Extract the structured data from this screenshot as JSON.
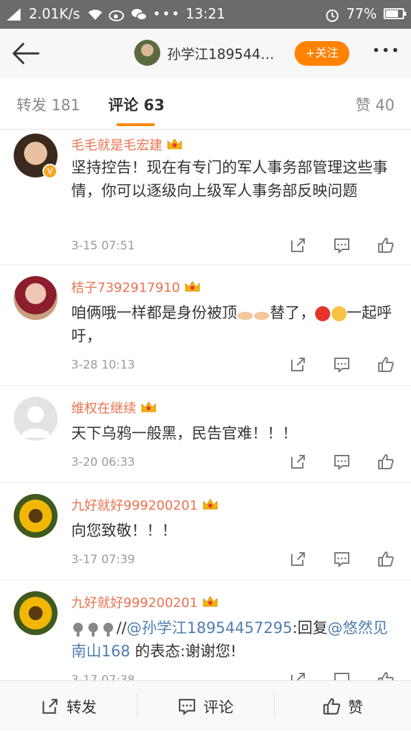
{
  "status_bar": {
    "speed": "2.01K/s",
    "time": "13:21",
    "battery_percent": "77%",
    "battery_level": 0.77
  },
  "nav": {
    "user_name": "孙学江189544…",
    "follow_label": "+关注"
  },
  "tabs": {
    "repost": "转发 181",
    "comments": "评论 63",
    "likes": "赞 40"
  },
  "comments": [
    {
      "name": "毛毛就是毛宏建",
      "text": "坚持控告！现在有专门的军人事务部管理这些事情，你可以逐级向上级军人事务部反映问题",
      "time": "3-15 07:51"
    },
    {
      "name": "桔子7392917910",
      "text_before": "咱俩哦一样都是身份被顶",
      "text_middle": "替了，",
      "text_after": "一起呼吁，",
      "time": "3-28 10:13"
    },
    {
      "name": "维权在继续",
      "text": "天下乌鸦一般黑，民告官难！！！",
      "time": "3-20 06:33"
    },
    {
      "name": "九好就好999200201",
      "text": "向您致敬！！！",
      "time": "3-17 07:39"
    },
    {
      "name": "九好就好999200201",
      "text_prefix": "//",
      "mention1": "@孙学江18954457295",
      "text_mid": ":回复",
      "mention2": "@悠然见南山168",
      "text_end": " 的表态:谢谢您!",
      "time": "3-17 07:38"
    }
  ],
  "bottom_bar": {
    "repost": "转发",
    "comment": "评论",
    "like": "赞"
  },
  "colors": {
    "accent": "#ff8200",
    "name_orange": "#eb7350",
    "link_blue": "#507daf"
  }
}
